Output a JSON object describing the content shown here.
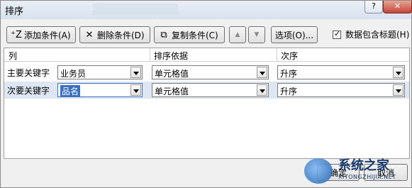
{
  "window": {
    "title": "排序"
  },
  "toolbar": {
    "add_label": "添加条件(A)",
    "delete_label": "删除条件(D)",
    "copy_label": "复制条件(C)",
    "options_label": "选项(O)...",
    "header_checkbox_label": "数据包含标题(H)",
    "header_checkbox_checked": true
  },
  "grid": {
    "headers": {
      "column": "列",
      "sort_on": "排序依据",
      "order": "次序"
    },
    "rows": [
      {
        "label": "主要关键字",
        "column": "业务员",
        "sort_on": "单元格值",
        "order": "升序"
      },
      {
        "label": "次要关键字",
        "column": "品名",
        "sort_on": "单元格值",
        "order": "升序"
      }
    ]
  },
  "footer": {
    "ok_label": "确定",
    "cancel_label": "取消"
  },
  "watermark": {
    "brand": "系统之家",
    "url": "XITONGZHIJIA.NET"
  },
  "icons": {
    "add": "add-condition-icon",
    "delete": "delete-x-icon",
    "copy": "copy-icon",
    "up": "move-up-icon",
    "down": "move-down-icon"
  }
}
